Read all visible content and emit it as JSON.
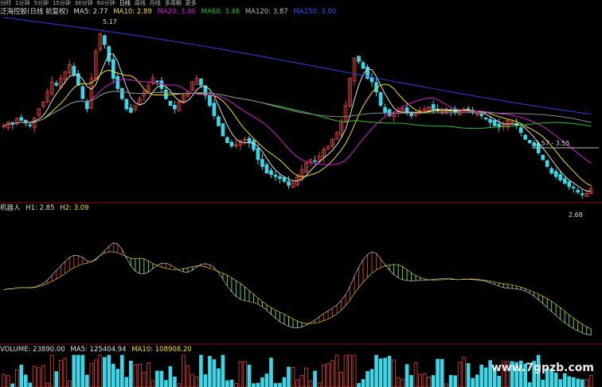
{
  "toolbar": {
    "items": [
      "分时",
      "1分钟",
      "5分钟",
      "15分钟",
      "30分钟",
      "60分钟",
      "日线",
      "周线",
      "月线",
      "多周期",
      "更多"
    ],
    "active": "日线"
  },
  "main_legend": {
    "title": "泛海控股(日线 前复权)",
    "ma5": "MA5: 2.77",
    "ma10": "MA10: 2.89",
    "ma20": "MA20: 3.00",
    "ma60": "MA60: 3.46",
    "ma120": "MA120: 3.87",
    "ma250": "MA250: 3.90"
  },
  "indicator_legend": {
    "name": "机器人",
    "h1": "H1: 2.85",
    "h2": "H2: 3.09"
  },
  "volume_legend": {
    "volume": "VOLUME: 23890.00",
    "ma5": "MA5: 125404.94",
    "ma10": "MA10: 108908.20"
  },
  "annotations": {
    "high_label": "5.17",
    "range_label": "3.57 - 3.55",
    "low_label": "2.68"
  },
  "watermark": "www.7gpzb.com",
  "colors": {
    "up": "#e8433c",
    "down": "#3dd6e6",
    "ma5": "#e0e0e0",
    "ma10": "#f0e020",
    "ma20": "#d020d0",
    "ma60": "#30c030",
    "ma120": "#8a8a8a",
    "ma250": "#3040e0",
    "ind_up": "#c83a30",
    "ind_down": "#6ad060"
  },
  "chart_data": {
    "type": "line",
    "title": "泛海控股(日线 前复权)",
    "close": [
      3.7,
      3.75,
      3.72,
      3.8,
      3.78,
      3.74,
      3.7,
      3.82,
      3.95,
      4.05,
      4.2,
      4.35,
      4.3,
      4.4,
      4.5,
      4.6,
      4.45,
      4.3,
      4.1,
      3.95,
      4.4,
      4.8,
      5.05,
      4.9,
      4.65,
      4.4,
      4.25,
      4.1,
      3.95,
      3.9,
      4.0,
      4.1,
      4.2,
      4.3,
      4.4,
      4.35,
      4.25,
      4.1,
      4.0,
      3.95,
      4.05,
      4.15,
      4.2,
      4.35,
      4.4,
      4.3,
      4.15,
      4.0,
      3.85,
      3.7,
      3.55,
      3.45,
      3.4,
      3.42,
      3.48,
      3.5,
      3.45,
      3.35,
      3.2,
      3.1,
      3.0,
      2.98,
      2.95,
      2.92,
      2.88,
      2.82,
      2.85,
      2.95,
      3.05,
      3.15,
      3.2,
      3.18,
      3.25,
      3.35,
      3.4,
      3.5,
      3.6,
      3.75,
      4.0,
      4.4,
      4.7,
      4.65,
      4.55,
      4.4,
      4.35,
      4.2,
      4.0,
      3.9,
      3.85,
      3.88,
      3.92,
      3.95,
      3.9,
      3.85,
      3.88,
      3.92,
      3.95,
      3.98,
      3.95,
      3.92,
      3.9,
      3.95,
      3.92,
      3.9,
      3.92,
      3.95,
      3.92,
      3.9,
      3.88,
      3.85,
      3.8,
      3.75,
      3.7,
      3.68,
      3.72,
      3.78,
      3.75,
      3.7,
      3.6,
      3.5,
      3.45,
      3.4,
      3.3,
      3.2,
      3.1,
      3.0,
      2.95,
      2.9,
      2.85,
      2.8,
      2.78,
      2.72,
      2.68,
      2.7,
      2.77
    ],
    "indicator": {
      "name": "机器人",
      "h1_last": 2.85,
      "h2_last": 3.09
    },
    "volume": {
      "last": 23890.0,
      "ma5": 125404.94,
      "ma10": 108908.2
    },
    "ylim": [
      2.6,
      5.3
    ]
  }
}
